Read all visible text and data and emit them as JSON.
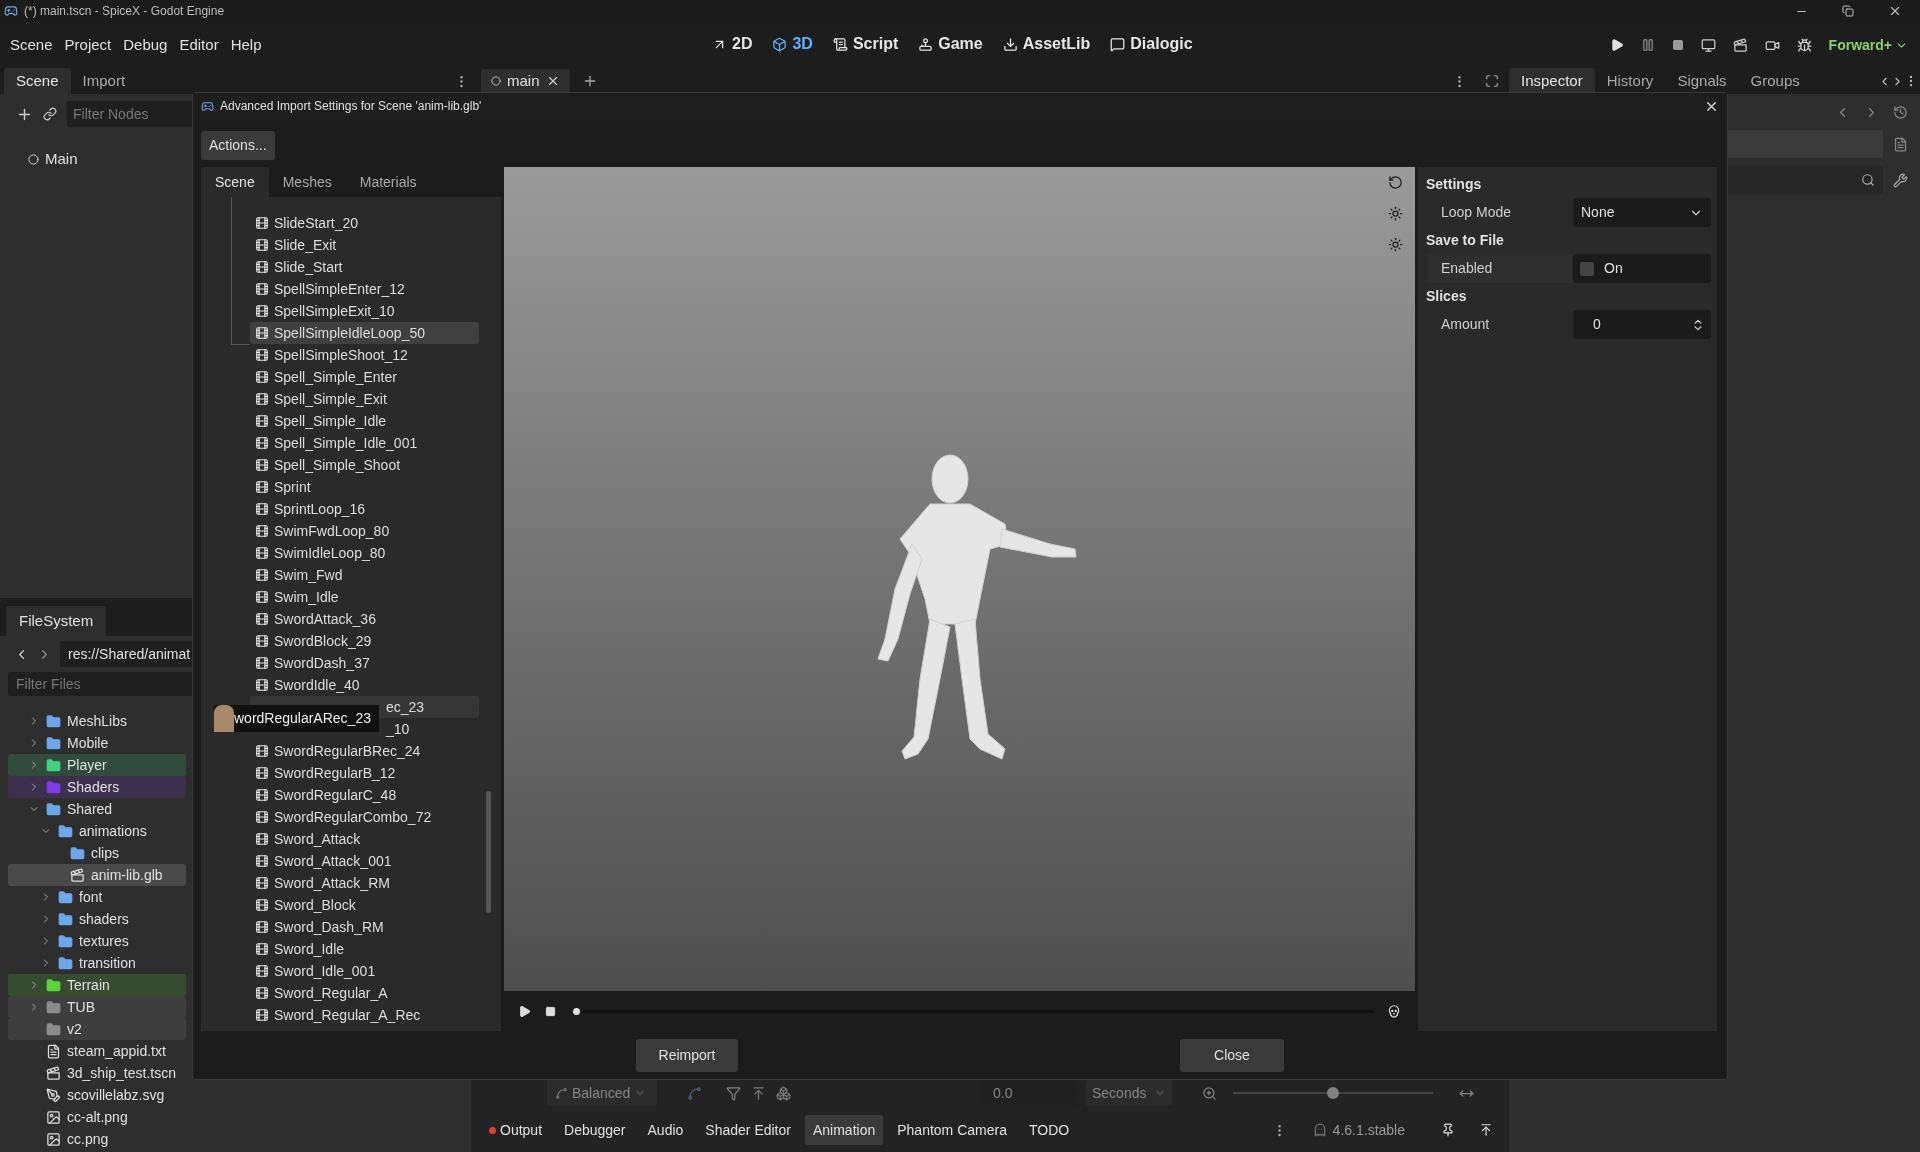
{
  "window": {
    "title": "(*) main.tscn - SpiceX - Godot Engine"
  },
  "menu": [
    "Scene",
    "Project",
    "Debug",
    "Editor",
    "Help"
  ],
  "workspaces": [
    {
      "label": "2D",
      "selected": false
    },
    {
      "label": "3D",
      "selected": true
    },
    {
      "label": "Script",
      "selected": false
    },
    {
      "label": "Game",
      "selected": false
    },
    {
      "label": "AssetLib",
      "selected": false
    },
    {
      "label": "Dialogic",
      "selected": false
    }
  ],
  "renderer": "Forward+",
  "scene_dock": {
    "tabs": [
      {
        "label": "Scene",
        "selected": true
      },
      {
        "label": "Import",
        "selected": false
      }
    ],
    "filter": {
      "placeholder": "Filter Nodes"
    },
    "root": "Main"
  },
  "editor_tabs": [
    {
      "label": "main",
      "selected": true
    }
  ],
  "filesystem": {
    "tab": "FileSystem",
    "path": "res://Shared/animat",
    "filter": {
      "placeholder": "Filter Files"
    },
    "tree": [
      {
        "kind": "folder",
        "label": "MeshLibs",
        "expanded": false,
        "selected": false
      },
      {
        "kind": "folder",
        "label": "Mobile",
        "expanded": false,
        "selected": false
      },
      {
        "kind": "folder",
        "label": "Player",
        "expanded": false,
        "selected": false,
        "color": "#45d07f"
      },
      {
        "kind": "folder",
        "label": "Shaders",
        "expanded": false,
        "selected": false,
        "color": "#7f3de6"
      },
      {
        "kind": "folder",
        "label": "Shared",
        "expanded": true,
        "selected": false,
        "children": [
          {
            "kind": "folder",
            "label": "animations",
            "expanded": true,
            "selected": false,
            "children": [
              {
                "kind": "folder",
                "label": "clips",
                "selected": false
              },
              {
                "kind": "scene",
                "label": "anim-lib.glb",
                "selected": true
              }
            ]
          },
          {
            "kind": "folder",
            "label": "font",
            "expanded": false,
            "selected": false
          },
          {
            "kind": "folder",
            "label": "shaders",
            "expanded": false,
            "selected": false
          },
          {
            "kind": "folder",
            "label": "textures",
            "expanded": false,
            "selected": false
          },
          {
            "kind": "folder",
            "label": "transition",
            "expanded": false,
            "selected": false
          }
        ]
      },
      {
        "kind": "folder",
        "label": "Terrain",
        "expanded": false,
        "selected": false,
        "color": "#5fd33c"
      },
      {
        "kind": "folder",
        "label": "TUB",
        "expanded": false,
        "selected": false,
        "color": "#8c8c8c"
      },
      {
        "kind": "folder",
        "label": "v2",
        "selected": false,
        "color": "#8c8c8c"
      },
      {
        "kind": "text",
        "label": "steam_appid.txt",
        "selected": false
      },
      {
        "kind": "scene",
        "label": "3d_ship_test.tscn",
        "selected": false
      },
      {
        "kind": "vector",
        "label": "scovillelabz.svg",
        "selected": false
      },
      {
        "kind": "image",
        "label": "cc-alt.png",
        "selected": false
      },
      {
        "kind": "image",
        "label": "cc.png",
        "selected": false
      }
    ]
  },
  "inspector": {
    "tabs": [
      {
        "label": "Inspector",
        "selected": true
      },
      {
        "label": "History",
        "selected": false
      },
      {
        "label": "Signals",
        "selected": false
      },
      {
        "label": "Groups",
        "selected": false
      }
    ]
  },
  "bottom_panel": {
    "blend": "Balanced",
    "time": "0.0",
    "unit": "Seconds",
    "zoom": {
      "level": 0.5
    },
    "tabs": [
      {
        "label": "Output",
        "selected": false,
        "has_errors": true
      },
      {
        "label": "Debugger",
        "selected": false,
        "has_errors": false
      },
      {
        "label": "Audio",
        "selected": false,
        "has_errors": false
      },
      {
        "label": "Shader Editor",
        "selected": false,
        "has_errors": false
      },
      {
        "label": "Animation",
        "selected": true,
        "has_errors": false
      },
      {
        "label": "Phantom Camera",
        "selected": false,
        "has_errors": false
      },
      {
        "label": "TODO",
        "selected": false,
        "has_errors": false
      }
    ],
    "version": "4.6.1.stable"
  },
  "dialog": {
    "title": "Advanced Import Settings for Scene 'anim-lib.glb'",
    "actions": "Actions...",
    "tabs": [
      {
        "label": "Scene",
        "selected": true
      },
      {
        "label": "Meshes",
        "selected": false
      },
      {
        "label": "Materials",
        "selected": false
      }
    ],
    "rows_above": [
      {
        "label": "SlideStart_20",
        "selected": false
      },
      {
        "label": "Slide_Exit",
        "selected": false
      },
      {
        "label": "Slide_Start",
        "selected": false
      },
      {
        "label": "SpellSimpleEnter_12",
        "selected": false
      },
      {
        "label": "SpellSimpleExit_10",
        "selected": false
      },
      {
        "label": "SpellSimpleIdleLoop_50",
        "selected": true
      },
      {
        "label": "SpellSimpleShoot_12",
        "selected": false
      },
      {
        "label": "Spell_Simple_Enter",
        "selected": false
      },
      {
        "label": "Spell_Simple_Exit",
        "selected": false
      },
      {
        "label": "Spell_Simple_Idle",
        "selected": false
      },
      {
        "label": "Spell_Simple_Idle_001",
        "selected": false
      },
      {
        "label": "Spell_Simple_Shoot",
        "selected": false
      },
      {
        "label": "Sprint",
        "selected": false
      },
      {
        "label": "SprintLoop_16",
        "selected": false
      },
      {
        "label": "SwimFwdLoop_80",
        "selected": false
      },
      {
        "label": "SwimIdleLoop_80",
        "selected": false
      },
      {
        "label": "Swim_Fwd",
        "selected": false
      },
      {
        "label": "Swim_Idle",
        "selected": false
      },
      {
        "label": "SwordAttack_36",
        "selected": false
      },
      {
        "label": "SwordBlock_29",
        "selected": false
      },
      {
        "label": "SwordDash_37",
        "selected": false
      },
      {
        "label": "SwordIdle_40",
        "selected": false
      }
    ],
    "covered_rows": [
      {
        "label": "ec_23",
        "hovered": true
      },
      {
        "label": "_10",
        "hovered": false
      }
    ],
    "tooltip": "wordRegularARec_23",
    "rows_below": [
      {
        "label": "SwordRegularBRec_24",
        "selected": false
      },
      {
        "label": "SwordRegularB_12",
        "selected": false
      },
      {
        "label": "SwordRegularC_48",
        "selected": false
      },
      {
        "label": "SwordRegularCombo_72",
        "selected": false
      },
      {
        "label": "Sword_Attack",
        "selected": false
      },
      {
        "label": "Sword_Attack_001",
        "selected": false
      },
      {
        "label": "Sword_Attack_RM",
        "selected": false
      },
      {
        "label": "Sword_Block",
        "selected": false
      },
      {
        "label": "Sword_Dash_RM",
        "selected": false
      },
      {
        "label": "Sword_Idle",
        "selected": false
      },
      {
        "label": "Sword_Idle_001",
        "selected": false
      },
      {
        "label": "Sword_Regular_A",
        "selected": false
      },
      {
        "label": "Sword_Regular_A_Rec",
        "selected": false
      }
    ],
    "timeline": {
      "level": 0
    },
    "settings": [
      {
        "kind": "section",
        "label": "Settings"
      },
      {
        "kind": "dropdown",
        "label": "Loop Mode",
        "value": "None"
      },
      {
        "kind": "section",
        "label": "Save to File"
      },
      {
        "kind": "checkbox",
        "label": "Enabled",
        "text": "On",
        "checked": false
      },
      {
        "kind": "section",
        "label": "Slices"
      },
      {
        "kind": "spinbox",
        "label": "Amount",
        "value": "0"
      }
    ],
    "buttons": [
      "Reimport",
      "Close"
    ]
  }
}
